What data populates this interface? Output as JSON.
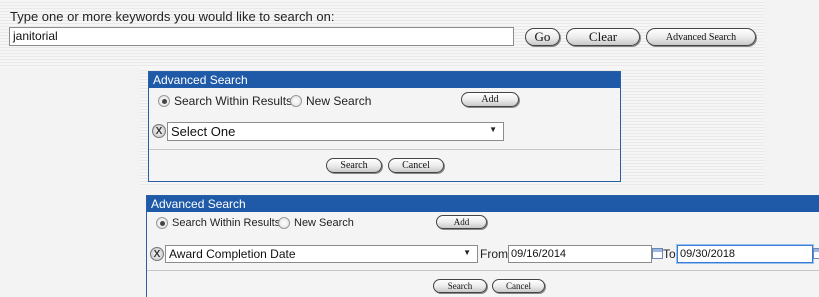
{
  "search": {
    "prompt": "Type one or more keywords you would like to search on:",
    "keyword_value": "janitorial",
    "go_label": "Go",
    "clear_label": "Clear",
    "advanced_label": "Advanced Search"
  },
  "panel1": {
    "title": "Advanced Search",
    "within_label": "Search Within Results",
    "new_label": "New Search",
    "add_label": "Add",
    "field_value": "Select One",
    "search_label": "Search",
    "cancel_label": "Cancel"
  },
  "panel2": {
    "title": "Advanced Search",
    "within_label": "Search Within Results",
    "new_label": "New Search",
    "add_label": "Add",
    "field_value": "Award Completion Date",
    "from_label": "From",
    "from_value": "09/16/2014",
    "to_label": "To",
    "to_value": "09/30/2018",
    "search_label": "Search",
    "cancel_label": "Cancel"
  }
}
